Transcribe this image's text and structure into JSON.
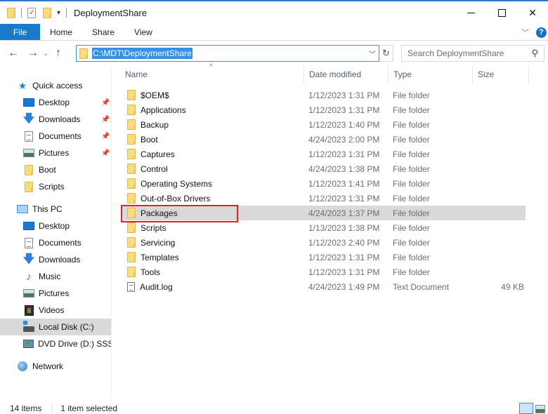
{
  "window": {
    "title": "DeploymentShare",
    "controls": {
      "minimize": "minimize",
      "maximize": "maximize",
      "close": "close"
    }
  },
  "ribbon": {
    "tabs": [
      {
        "label": "File",
        "active": true
      },
      {
        "label": "Home"
      },
      {
        "label": "Share"
      },
      {
        "label": "View"
      }
    ],
    "help": "?"
  },
  "navigation": {
    "back": "←",
    "forward": "→",
    "recent": "⌄",
    "up": "↑",
    "address": "C:\\MDT\\DeploymentShare",
    "refresh": "↻",
    "search_placeholder": "Search DeploymentShare"
  },
  "sidebar": {
    "quick_access": {
      "label": "Quick access",
      "items": [
        {
          "label": "Desktop",
          "icon": "desktop-icon",
          "pinned": true
        },
        {
          "label": "Downloads",
          "icon": "downloads-icon",
          "pinned": true
        },
        {
          "label": "Documents",
          "icon": "documents-icon",
          "pinned": true
        },
        {
          "label": "Pictures",
          "icon": "pictures-icon",
          "pinned": true
        },
        {
          "label": "Boot",
          "icon": "folder-icon",
          "pinned": false
        },
        {
          "label": "Scripts",
          "icon": "folder-icon",
          "pinned": false
        }
      ]
    },
    "this_pc": {
      "label": "This PC",
      "items": [
        {
          "label": "Desktop",
          "icon": "desktop-icon"
        },
        {
          "label": "Documents",
          "icon": "documents-icon"
        },
        {
          "label": "Downloads",
          "icon": "downloads-icon"
        },
        {
          "label": "Music",
          "icon": "music-icon"
        },
        {
          "label": "Pictures",
          "icon": "pictures-icon"
        },
        {
          "label": "Videos",
          "icon": "videos-icon"
        },
        {
          "label": "Local Disk (C:)",
          "icon": "local-disk-icon",
          "selected": true
        },
        {
          "label": "DVD Drive (D:) SSS_X",
          "icon": "dvd-drive-icon"
        }
      ]
    },
    "network": {
      "label": "Network"
    }
  },
  "list": {
    "columns": [
      "Name",
      "Date modified",
      "Type",
      "Size"
    ],
    "sort_indicator": "^",
    "rows": [
      {
        "name": "$OEM$",
        "date": "1/12/2023 1:31 PM",
        "type": "File folder",
        "size": "",
        "kind": "folder"
      },
      {
        "name": "Applications",
        "date": "1/12/2023 1:31 PM",
        "type": "File folder",
        "size": "",
        "kind": "folder"
      },
      {
        "name": "Backup",
        "date": "1/12/2023 1:40 PM",
        "type": "File folder",
        "size": "",
        "kind": "folder"
      },
      {
        "name": "Boot",
        "date": "4/24/2023 2:00 PM",
        "type": "File folder",
        "size": "",
        "kind": "folder"
      },
      {
        "name": "Captures",
        "date": "1/12/2023 1:31 PM",
        "type": "File folder",
        "size": "",
        "kind": "folder"
      },
      {
        "name": "Control",
        "date": "4/24/2023 1:38 PM",
        "type": "File folder",
        "size": "",
        "kind": "folder"
      },
      {
        "name": "Operating Systems",
        "date": "1/12/2023 1:41 PM",
        "type": "File folder",
        "size": "",
        "kind": "folder"
      },
      {
        "name": "Out-of-Box Drivers",
        "date": "1/12/2023 1:31 PM",
        "type": "File folder",
        "size": "",
        "kind": "folder"
      },
      {
        "name": "Packages",
        "date": "4/24/2023 1:37 PM",
        "type": "File folder",
        "size": "",
        "kind": "folder",
        "selected": true
      },
      {
        "name": "Scripts",
        "date": "1/13/2023 1:38 PM",
        "type": "File folder",
        "size": "",
        "kind": "folder"
      },
      {
        "name": "Servicing",
        "date": "1/12/2023 2:40 PM",
        "type": "File folder",
        "size": "",
        "kind": "folder"
      },
      {
        "name": "Templates",
        "date": "1/12/2023 1:31 PM",
        "type": "File folder",
        "size": "",
        "kind": "folder"
      },
      {
        "name": "Tools",
        "date": "1/12/2023 1:31 PM",
        "type": "File folder",
        "size": "",
        "kind": "folder"
      },
      {
        "name": "Audit.log",
        "date": "4/24/2023 1:49 PM",
        "type": "Text Document",
        "size": "49 KB",
        "kind": "text"
      }
    ]
  },
  "status": {
    "item_count": "14 items",
    "selection": "1 item selected"
  },
  "colors": {
    "accent": "#1979ca",
    "selection": "#d9d9d9",
    "highlight_box": "#e0202a"
  }
}
